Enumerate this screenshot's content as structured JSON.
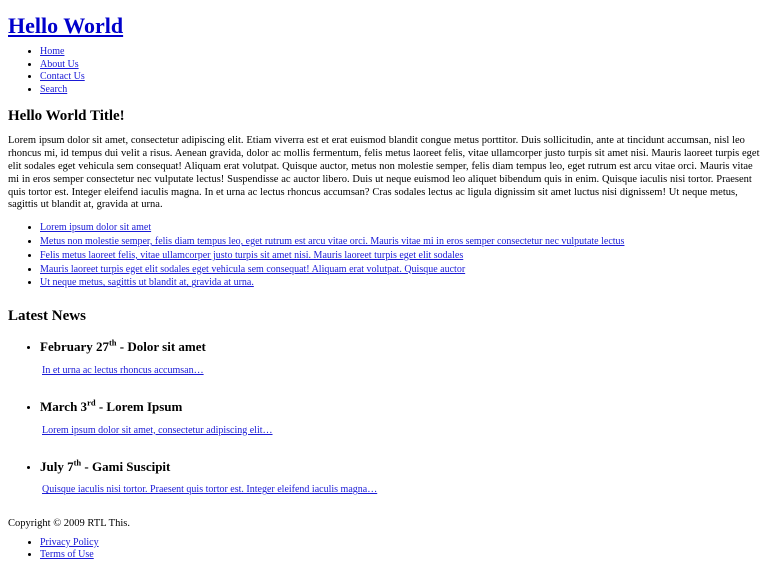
{
  "colors": {
    "link": "#1a1ad6",
    "title_link": "#0000cc",
    "text": "#000000",
    "background": "#ffffff"
  },
  "header": {
    "site_title": "Hello World",
    "nav": [
      {
        "label": "Home"
      },
      {
        "label": "About Us"
      },
      {
        "label": "Contact Us"
      },
      {
        "label": "Search"
      }
    ]
  },
  "main": {
    "heading": "Hello World Title!",
    "intro_paragraph": "Lorem ipsum dolor sit amet, consectetur adipiscing elit. Etiam viverra est et erat euismod blandit congue metus porttitor. Duis sollicitudin, ante at tincidunt accumsan, nisl leo rhoncus mi, id tempus dui velit a risus. Aenean gravida, dolor ac mollis fermentum, felis metus laoreet felis, vitae ullamcorper justo turpis sit amet nisi. Mauris laoreet turpis eget elit sodales eget vehicula sem consequat! Aliquam erat volutpat. Quisque auctor, metus non molestie semper, felis diam tempus leo, eget rutrum est arcu vitae orci. Mauris vitae mi in eros semper consectetur nec vulputate lectus! Suspendisse ac auctor libero. Duis ut neque euismod leo aliquet bibendum quis in enim. Quisque iaculis nisi tortor. Praesent quis tortor est. Integer eleifend iaculis magna. In et urna ac lectus rhoncus accumsan? Cras sodales lectus ac ligula dignissim sit amet luctus nisi dignissem! Ut neque metus, sagittis ut blandit at, gravida at urna.",
    "link_list": [
      {
        "label": "Lorem ipsum dolor sit amet"
      },
      {
        "label": "Metus non molestie semper, felis diam tempus leo, eget rutrum est arcu vitae orci. Mauris vitae mi in eros semper consectetur nec vulputate lectus"
      },
      {
        "label": "Felis metus laoreet felis, vitae ullamcorper justo turpis sit amet nisi. Mauris laoreet turpis eget elit sodales"
      },
      {
        "label": "Mauris laoreet turpis eget elit sodales eget vehicula sem consequat! Aliquam erat volutpat. Quisque auctor"
      },
      {
        "label": "Ut neque metus, sagittis ut blandit at, gravida at urna."
      }
    ]
  },
  "news": {
    "heading": "Latest News",
    "items": [
      {
        "month_day": "February 27",
        "ordinal": "th",
        "separator": " - ",
        "title": "Dolor sit amet",
        "excerpt": "In et urna ac lectus rhoncus accumsan…"
      },
      {
        "month_day": "March 3",
        "ordinal": "rd",
        "separator": " - ",
        "title": "Lorem Ipsum",
        "excerpt": "Lorem ipsum dolor sit amet, consectetur adipiscing elit…"
      },
      {
        "month_day": "July 7",
        "ordinal": "th",
        "separator": " - ",
        "title": "Gami Suscipit",
        "excerpt": "Quisque iaculis nisi tortor. Praesent quis tortor est. Integer eleifend iaculis magna…"
      }
    ]
  },
  "footer": {
    "copyright": "Copyright © 2009 RTL This.",
    "links": [
      {
        "label": "Privacy Policy"
      },
      {
        "label": "Terms of Use"
      }
    ]
  }
}
